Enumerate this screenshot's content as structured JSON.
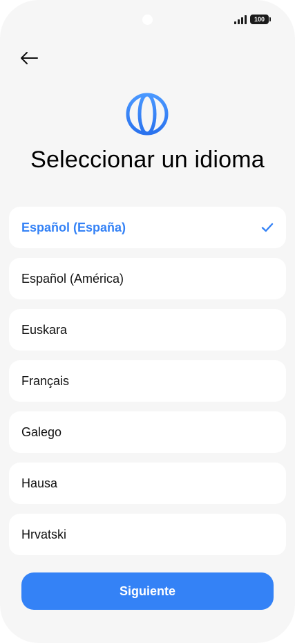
{
  "status_bar": {
    "battery_level": "100",
    "icons": [
      "camera-cutout",
      "signal-icon",
      "battery-icon"
    ]
  },
  "header": {
    "back_icon": "arrow-left-icon",
    "globe_icon": "globe-icon",
    "title": "Seleccionar un idioma"
  },
  "languages": [
    {
      "label": "Español (España)",
      "selected": true
    },
    {
      "label": "Español (América)",
      "selected": false
    },
    {
      "label": "Euskara",
      "selected": false
    },
    {
      "label": "Français",
      "selected": false
    },
    {
      "label": "Galego",
      "selected": false
    },
    {
      "label": "Hausa",
      "selected": false
    },
    {
      "label": "Hrvatski",
      "selected": false
    }
  ],
  "footer": {
    "next_label": "Siguiente"
  },
  "colors": {
    "accent": "#3482f6",
    "background": "#f6f6f6",
    "card": "#ffffff",
    "text": "#111111"
  }
}
